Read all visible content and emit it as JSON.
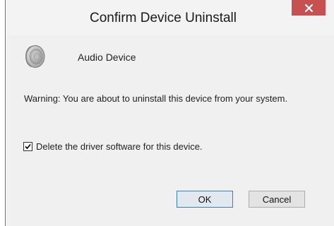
{
  "dialog": {
    "title": "Confirm Device Uninstall",
    "close_icon": "close-icon",
    "device_icon": "speaker-icon",
    "device_name": "Audio Device",
    "warning": "Warning: You are about to uninstall this device from your system.",
    "checkbox": {
      "label": "Delete the driver software for this device.",
      "checked": true
    },
    "ok_label": "OK",
    "cancel_label": "Cancel"
  },
  "colors": {
    "close_button": "#c75050",
    "dialog_background": "#f0f0f0",
    "primary_button_border": "#3c7fb1"
  }
}
